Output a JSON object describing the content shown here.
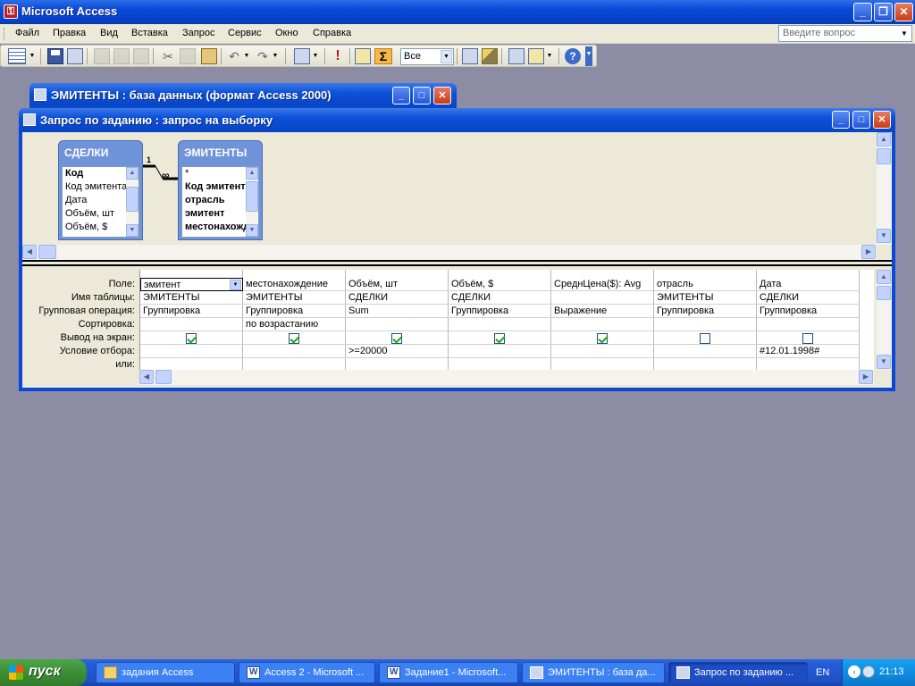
{
  "app": {
    "title": "Microsoft Access"
  },
  "menu": {
    "items": [
      "Файл",
      "Правка",
      "Вид",
      "Вставка",
      "Запрос",
      "Сервис",
      "Окно",
      "Справка"
    ],
    "help_placeholder": "Введите вопрос"
  },
  "toolbar": {
    "top_values": "Все"
  },
  "db_window": {
    "title": "ЭМИТЕНТЫ : база данных (формат Access 2000)"
  },
  "query_window": {
    "title": "Запрос по заданию : запрос на выборку",
    "relation": {
      "one": "1",
      "many": "∞"
    },
    "tables": [
      {
        "name": "СДЕЛКИ",
        "fields": [
          "Код",
          "Код эмитента",
          "Дата",
          "Объём, шт",
          "Объём, $"
        ]
      },
      {
        "name": "ЭМИТЕНТЫ",
        "fields": [
          "*",
          "Код эмитента",
          "отрасль",
          "эмитент",
          "местонахождение"
        ]
      }
    ],
    "row_labels": [
      "Поле:",
      "Имя таблицы:",
      "Групповая операция:",
      "Сортировка:",
      "Вывод на экран:",
      "Условие отбора:",
      "или:"
    ],
    "columns": [
      {
        "field": "эмитент",
        "table": "ЭМИТЕНТЫ",
        "total": "Группировка",
        "sort": "",
        "show": true,
        "criteria": ""
      },
      {
        "field": "местонахождение",
        "table": "ЭМИТЕНТЫ",
        "total": "Группировка",
        "sort": "по возрастанию",
        "show": true,
        "criteria": ""
      },
      {
        "field": "Объём, шт",
        "table": "СДЕЛКИ",
        "total": "Sum",
        "sort": "",
        "show": true,
        "criteria": ">=20000"
      },
      {
        "field": "Объём, $",
        "table": "СДЕЛКИ",
        "total": "Группировка",
        "sort": "",
        "show": true,
        "criteria": ""
      },
      {
        "field": "СреднЦена($): Avg",
        "table": "",
        "total": "Выражение",
        "sort": "",
        "show": true,
        "criteria": ""
      },
      {
        "field": "отрасль",
        "table": "ЭМИТЕНТЫ",
        "total": "Группировка",
        "sort": "",
        "show": false,
        "criteria": ""
      },
      {
        "field": "Дата",
        "table": "СДЕЛКИ",
        "total": "Группировка",
        "sort": "",
        "show": false,
        "criteria": "#12.01.1998#"
      }
    ]
  },
  "taskbar": {
    "start": "пуск",
    "tasks": [
      {
        "label": "задания Access",
        "icon": "folder-icon"
      },
      {
        "label": "Access 2 - Microsoft ...",
        "icon": "word-icon"
      },
      {
        "label": "Задание1 - Microsoft...",
        "icon": "word-icon"
      },
      {
        "label": "ЭМИТЕНТЫ : база да...",
        "icon": "database-icon"
      },
      {
        "label": "Запрос по заданию ...",
        "icon": "query-icon"
      }
    ],
    "lang": "EN",
    "time": "21:13"
  }
}
